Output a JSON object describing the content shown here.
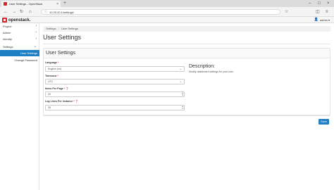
{
  "browser": {
    "tab_title": "User Settings - OpenStack",
    "tab_close": "×",
    "new_tab": "+",
    "url": "10.20.20.1/settings/",
    "win_min": "–",
    "win_max": "□",
    "win_close": "×"
  },
  "header": {
    "logo_text": "openstack.",
    "user_label": "admin ▾"
  },
  "sidebar": {
    "items": [
      {
        "label": "Project",
        "chev": "›"
      },
      {
        "label": "Admin",
        "chev": "›"
      },
      {
        "label": "Identity",
        "chev": "›"
      },
      {
        "label": "Settings",
        "chev": "⌄"
      },
      {
        "label": "User Settings"
      },
      {
        "label": "Change Password"
      }
    ]
  },
  "breadcrumb": {
    "root": "Settings",
    "sep": "/",
    "current": "User Settings"
  },
  "page_title": "User Settings",
  "panel_title": "User Settings",
  "form": {
    "language": {
      "label": "Language",
      "required": "*",
      "value": "English (en)"
    },
    "timezone": {
      "label": "Timezone",
      "required": "*",
      "value": "UTC"
    },
    "items_per_page": {
      "label": "Items Per Page",
      "required": "*",
      "value": "20"
    },
    "log_lines": {
      "label": "Log Lines Per Instance",
      "required": "*",
      "value": "35"
    }
  },
  "description": {
    "title": "Description:",
    "text": "Modify dashboard settings for your user."
  },
  "save_label": "Save",
  "colors": {
    "accent": "#1f7fc3",
    "brand": "#d9232e"
  }
}
